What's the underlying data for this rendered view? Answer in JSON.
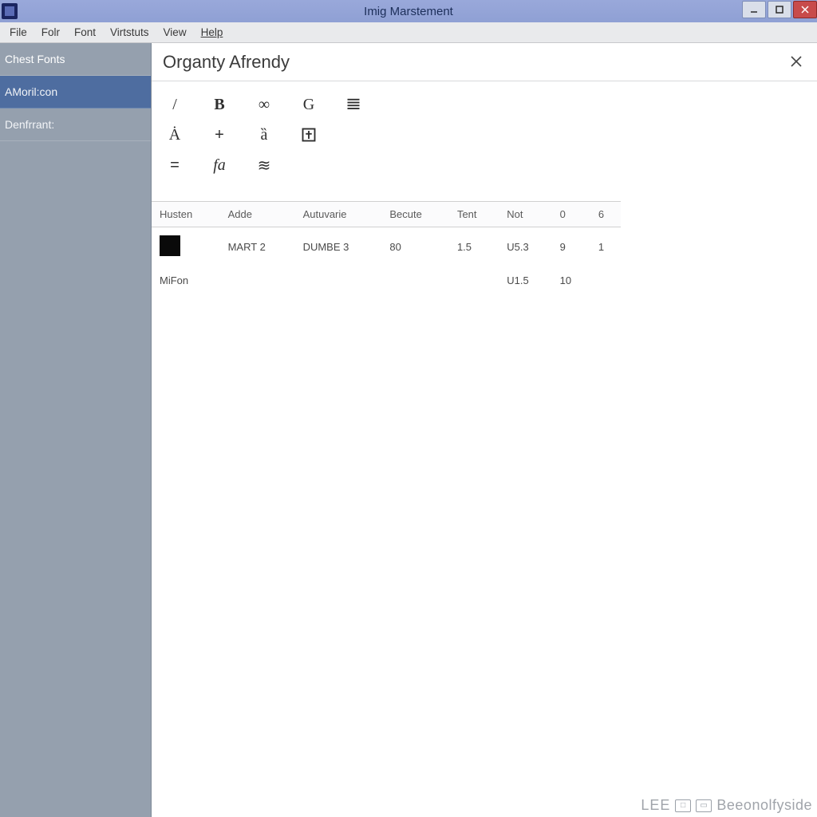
{
  "window": {
    "title": "Imig Marstement"
  },
  "menu": {
    "items": [
      "File",
      "Folr",
      "Font",
      "Virtstuts",
      "View",
      "Help"
    ]
  },
  "sidebar": {
    "items": [
      {
        "label": "Chest Fonts",
        "kind": "header"
      },
      {
        "label": "AMoril:con",
        "kind": "selected"
      },
      {
        "label": "Denfrrant:",
        "kind": "normal"
      }
    ]
  },
  "panel": {
    "title": "Organty Afrendy"
  },
  "glyphs": {
    "row1": [
      "/",
      "B",
      "∞",
      "G",
      "≣"
    ],
    "row2": [
      "Ȧ",
      "+",
      "ȁ",
      "⍂"
    ],
    "row3": [
      "=",
      "fa",
      "≋"
    ]
  },
  "table": {
    "columns": [
      "Husten",
      "Adde",
      "Autuvarie",
      "Becute",
      "Tent",
      "Not",
      "0",
      "6"
    ],
    "rows": [
      {
        "cells": [
          "",
          "MART 2",
          "DUMBE 3",
          "80",
          "1.5",
          "U5.3",
          "9",
          "1"
        ],
        "swatch": "#0a0a0a"
      },
      {
        "cells": [
          "MiFon",
          "",
          "",
          "",
          "",
          "U1.5",
          "10",
          ""
        ],
        "swatch": null
      }
    ]
  },
  "status": {
    "text": "LEE",
    "text2": "Beeonolfyside"
  }
}
